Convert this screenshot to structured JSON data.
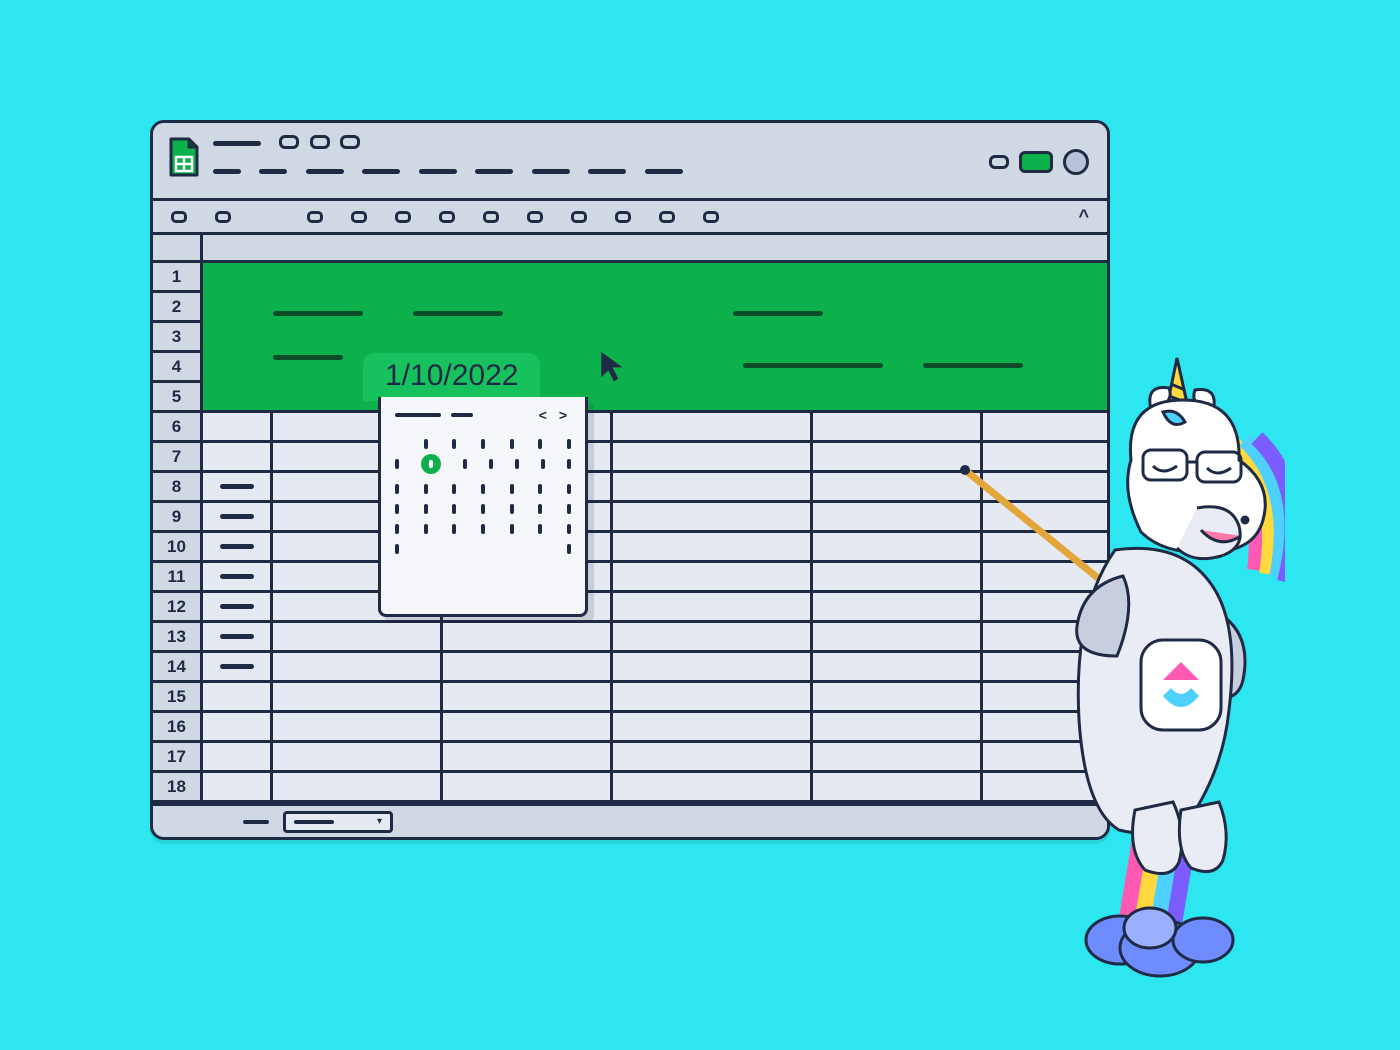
{
  "window": {
    "app": "spreadsheet",
    "collapse_glyph": "^"
  },
  "rows": [
    "1",
    "2",
    "3",
    "4",
    "5",
    "6",
    "7",
    "8",
    "9",
    "10",
    "11",
    "12",
    "13",
    "14",
    "15",
    "16",
    "17",
    "18"
  ],
  "date_input": {
    "value": "1/10/2022"
  },
  "datepicker": {
    "nav_glyph": "< >",
    "rows": 6,
    "cols": 7,
    "selected_row": 1,
    "selected_col": 1
  },
  "sheet_tab": {
    "caret": "▾"
  },
  "colors": {
    "background": "#2EE6F0",
    "accent": "#0DB14B",
    "stroke": "#1F2A44"
  }
}
